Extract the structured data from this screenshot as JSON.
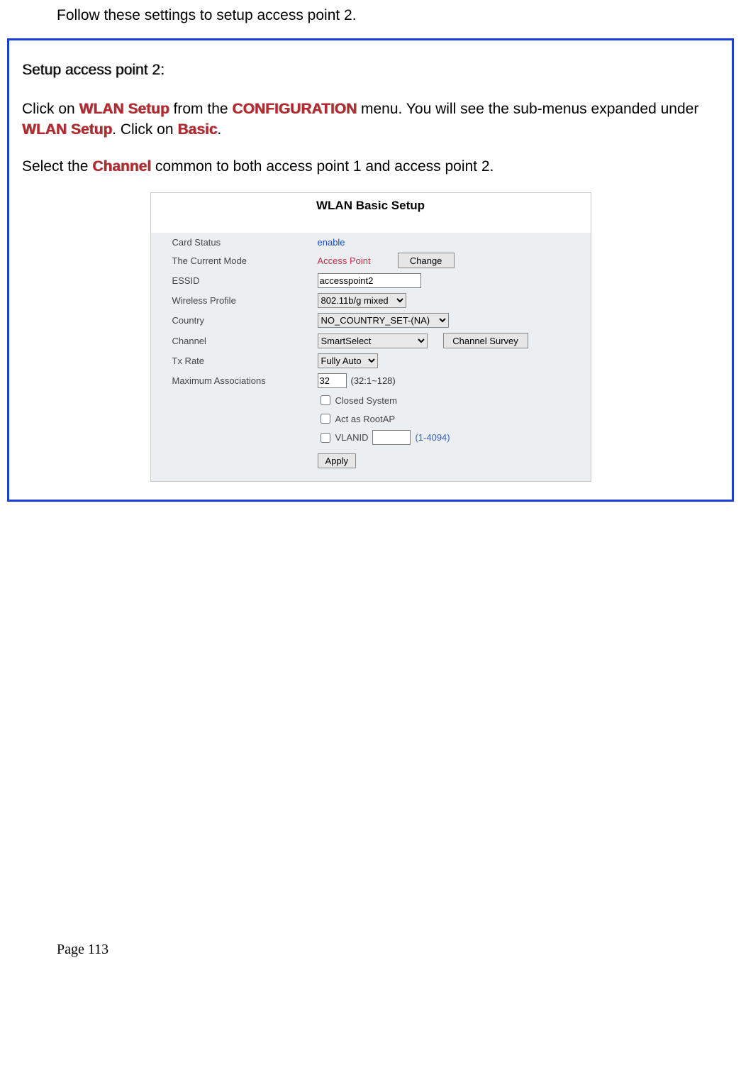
{
  "doc": {
    "intro": "Follow these settings to setup access point 2.",
    "heading": "Setup access point 2:",
    "p1_a": "Click on ",
    "p1_wlan": "WLAN Setup",
    "p1_b": " from the ",
    "p1_conf": "CONFIGURATION",
    "p1_c": " menu. You will see the sub-menus expanded under ",
    "p1_wlan2": "WLAN Setup",
    "p1_d": ". Click on ",
    "p1_basic": "Basic",
    "p1_e": ".",
    "p2_a": "Select the ",
    "p2_channel": "Channel",
    "p2_b": " common to both access point 1 and access point 2.",
    "page_footer": "Page 113"
  },
  "panel": {
    "title": "WLAN Basic Setup",
    "labels": {
      "card_status": "Card Status",
      "current_mode": "The Current Mode",
      "essid": "ESSID",
      "wireless_profile": "Wireless Profile",
      "country": "Country",
      "channel": "Channel",
      "tx_rate": "Tx Rate",
      "max_assoc": "Maximum Associations"
    },
    "values": {
      "card_status": "enable",
      "current_mode": "Access Point",
      "essid": "accesspoint2",
      "wireless_profile": "802.11b/g mixed",
      "country": "NO_COUNTRY_SET-(NA)",
      "channel": "SmartSelect",
      "tx_rate": "Fully Auto",
      "max_assoc": "32",
      "max_assoc_hint": "(32:1~128)",
      "vlanid_hint": "(1-4094)"
    },
    "checkboxes": {
      "closed_system": "Closed System",
      "act_as_rootap": "Act as RootAP",
      "vlanid": "VLANID"
    },
    "buttons": {
      "change": "Change",
      "channel_survey": "Channel Survey",
      "apply": "Apply"
    }
  }
}
